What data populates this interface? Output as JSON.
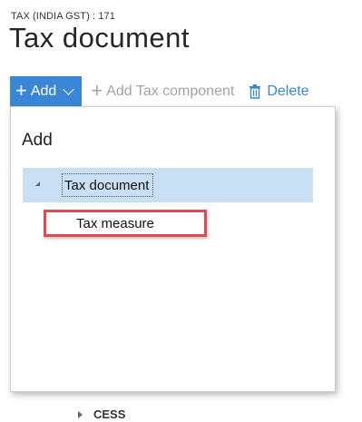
{
  "header": {
    "breadcrumb": "TAX (INDIA GST) : 171",
    "title": "Tax document"
  },
  "toolbar": {
    "add_label": "Add",
    "add_tax_component_label": "Add Tax component",
    "delete_label": "Delete",
    "accent_color": "#3a86d6"
  },
  "dropdown": {
    "title": "Add",
    "tree": {
      "selected_item": "Tax document",
      "child_item": "Tax measure"
    },
    "highlight_color": "#e5484d"
  },
  "background_list": {
    "item_label": "CESS"
  }
}
